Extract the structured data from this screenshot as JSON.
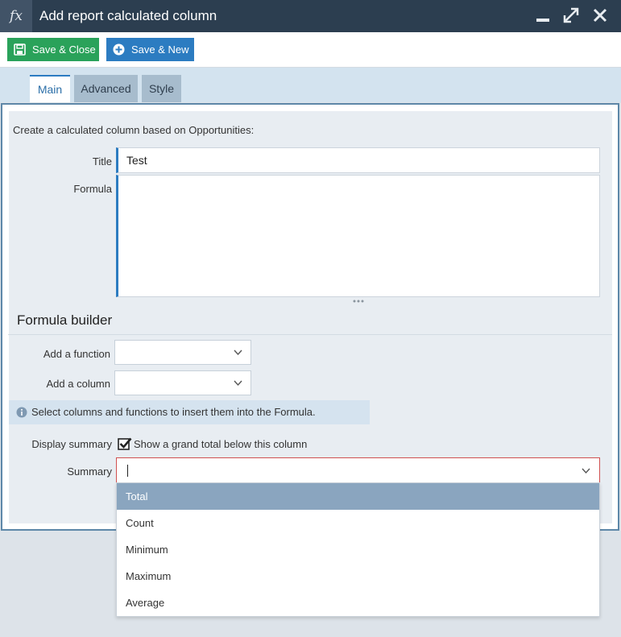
{
  "window": {
    "icon_text": "fx",
    "title": "Add report calculated column",
    "icons": {
      "app": "function-icon",
      "minimize": "minimize-icon",
      "maximize": "maximize-icon",
      "close": "close-icon"
    }
  },
  "toolbar": {
    "save_close_label": "Save & Close",
    "save_new_label": "Save & New",
    "save_close_color": "#2aa25a",
    "save_new_color": "#2c7cc1"
  },
  "tabs": [
    {
      "label": "Main",
      "active": true
    },
    {
      "label": "Advanced",
      "active": false
    },
    {
      "label": "Style",
      "active": false
    }
  ],
  "form": {
    "description": "Create a calculated column based on Opportunities:",
    "title_label": "Title",
    "title_value": "Test",
    "formula_label": "Formula",
    "formula_value": ""
  },
  "builder": {
    "heading": "Formula builder",
    "add_function_label": "Add a function",
    "add_function_value": "",
    "add_column_label": "Add a column",
    "add_column_value": "",
    "info_text": "Select columns and functions to insert them into the Formula."
  },
  "summary": {
    "display_label": "Display summary",
    "checkbox_checked": true,
    "checkbox_text": "Show a grand total below this column",
    "summary_label": "Summary",
    "summary_value": "",
    "options": [
      {
        "label": "Total",
        "highlighted": true
      },
      {
        "label": "Count",
        "highlighted": false
      },
      {
        "label": "Minimum",
        "highlighted": false
      },
      {
        "label": "Maximum",
        "highlighted": false
      },
      {
        "label": "Average",
        "highlighted": false
      }
    ]
  },
  "colors": {
    "titlebar": "#2c3e50",
    "accent": "#2c7cc1",
    "highlight": "#8aa5bf",
    "error_border": "#d05050"
  }
}
